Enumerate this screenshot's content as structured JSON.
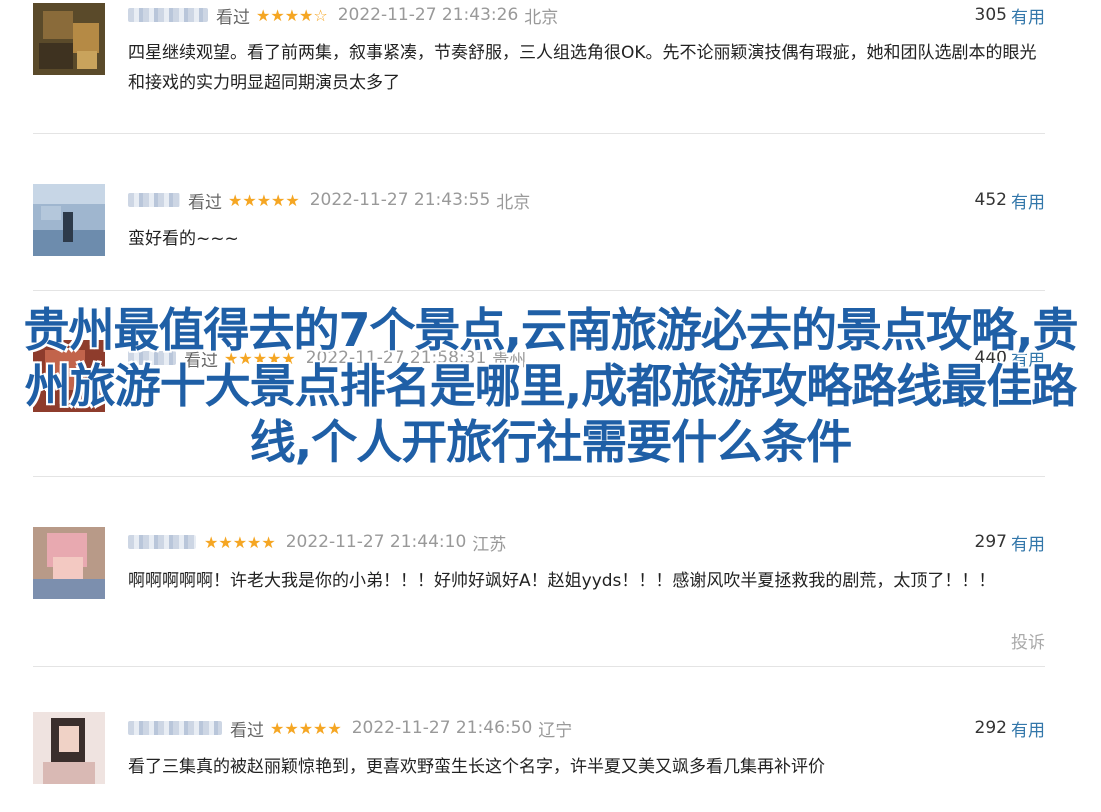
{
  "reviews": [
    {
      "watched": "看过",
      "stars": "★★★★☆",
      "time": "2022-11-27 21:43:26",
      "location": "北京",
      "useful_count": "305",
      "useful_label": "有用",
      "content": "四星继续观望。看了前两集，叙事紧凑，节奏舒服，三人组选角很OK。先不论丽颖演技偶有瑕疵，她和团队选剧本的眼光和接戏的实力明显超同期演员太多了"
    },
    {
      "watched": "看过",
      "stars": "★★★★★",
      "time": "2022-11-27 21:43:55",
      "location": "北京",
      "useful_count": "452",
      "useful_label": "有用",
      "content": "蛮好看的~~~"
    },
    {
      "watched": "看过",
      "stars": "★★★★★",
      "time": "2022-11-27 21:58:31",
      "location": "贵州",
      "useful_count": "440",
      "useful_label": "有用",
      "content": ""
    },
    {
      "watched": "",
      "stars": "★★★★★",
      "time": "2022-11-27 21:44:10",
      "location": "江苏",
      "useful_count": "297",
      "useful_label": "有用",
      "content": "啊啊啊啊啊！许老大我是你的小弟！！！好帅好飒好A！赵姐yyds！！！感谢风吹半夏拯救我的剧荒，太顶了！！！",
      "report": "投诉"
    },
    {
      "watched": "看过",
      "stars": "★★★★★",
      "time": "2022-11-27 21:46:50",
      "location": "辽宁",
      "useful_count": "292",
      "useful_label": "有用",
      "content": "看了三集真的被赵丽颖惊艳到，更喜欢野蛮生长这个名字，许半夏又美又飒多看几集再补评价"
    }
  ],
  "overlay_title": "贵州最值得去的7个景点,云南旅游必去的景点攻略,贵州旅游十大景点排名是哪里,成都旅游攻略路线最佳路线,个人开旅行社需要什么条件",
  "colors": {
    "star": "#f5a623",
    "link": "#3377aa",
    "overlay": "#1f5fa6"
  }
}
